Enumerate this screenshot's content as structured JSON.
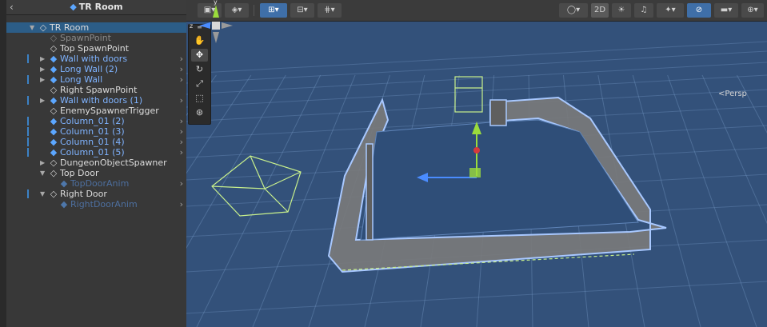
{
  "hierarchy": {
    "title": "TR Room",
    "back_icon": "chevron-left",
    "items": [
      {
        "label": "TR Room",
        "depth": 0,
        "arrow": "open",
        "icon": "cube-outline",
        "style": "white",
        "selected": true
      },
      {
        "label": "SpawnPoint",
        "depth": 1,
        "arrow": "",
        "icon": "cube-outline",
        "style": "dim"
      },
      {
        "label": "Top SpawnPoint",
        "depth": 1,
        "arrow": "",
        "icon": "cube-outline",
        "style": "white"
      },
      {
        "label": "Wall with doors",
        "depth": 1,
        "arrow": "closed",
        "icon": "prefab-cube",
        "style": "blue",
        "chevron": true,
        "bar": true
      },
      {
        "label": "Long Wall (2)",
        "depth": 1,
        "arrow": "closed",
        "icon": "prefab-cube",
        "style": "blue",
        "chevron": true
      },
      {
        "label": "Long Wall",
        "depth": 1,
        "arrow": "closed",
        "icon": "prefab-cube",
        "style": "blue",
        "chevron": true,
        "bar": true
      },
      {
        "label": "Right SpawnPoint",
        "depth": 1,
        "arrow": "",
        "icon": "cube-outline",
        "style": "white"
      },
      {
        "label": "Wall with doors (1)",
        "depth": 1,
        "arrow": "closed",
        "icon": "prefab-cube",
        "style": "blue",
        "chevron": true,
        "bar": true
      },
      {
        "label": "EnemySpawnerTrigger",
        "depth": 1,
        "arrow": "",
        "icon": "cube-outline",
        "style": "white"
      },
      {
        "label": "Column_01 (2)",
        "depth": 1,
        "arrow": "",
        "icon": "prefab-cube",
        "style": "blue",
        "chevron": true,
        "bar": true
      },
      {
        "label": "Column_01 (3)",
        "depth": 1,
        "arrow": "",
        "icon": "prefab-cube",
        "style": "blue",
        "chevron": true,
        "bar": true
      },
      {
        "label": "Column_01 (4)",
        "depth": 1,
        "arrow": "",
        "icon": "prefab-cube",
        "style": "blue",
        "chevron": true,
        "bar": true
      },
      {
        "label": "Column_01 (5)",
        "depth": 1,
        "arrow": "",
        "icon": "prefab-cube",
        "style": "blue",
        "chevron": true,
        "bar": true
      },
      {
        "label": "DungeonObjectSpawner",
        "depth": 1,
        "arrow": "closed",
        "icon": "cube-outline",
        "style": "white"
      },
      {
        "label": "Top Door",
        "depth": 1,
        "arrow": "open",
        "icon": "cube-outline",
        "style": "white"
      },
      {
        "label": "TopDoorAnim",
        "depth": 2,
        "arrow": "",
        "icon": "prefab-cube",
        "style": "bluedim",
        "chevron": true
      },
      {
        "label": "Right Door",
        "depth": 1,
        "arrow": "open",
        "icon": "cube-outline",
        "style": "white",
        "bar": true
      },
      {
        "label": "RightDoorAnim",
        "depth": 2,
        "arrow": "",
        "icon": "prefab-cube",
        "style": "bluedim",
        "chevron": true
      }
    ]
  },
  "scene": {
    "toolbar": {
      "mode_2d": "2D",
      "left_buttons": [
        "draw-mode-icon",
        "gizmo-dropdown-icon",
        "grid-snap-icon",
        "increment-snap-icon",
        "ruler-icon"
      ],
      "right_buttons": [
        "shading-mode-icon",
        "2d-toggle",
        "lighting-icon",
        "audio-icon",
        "effects-icon",
        "hidden-objects-icon",
        "camera-icon",
        "gizmos-icon"
      ]
    },
    "tools": [
      "hand-tool-icon",
      "move-tool-icon",
      "rotate-tool-icon",
      "scale-tool-icon",
      "rect-tool-icon",
      "transform-tool-icon"
    ],
    "projection_label": "Persp",
    "axes": {
      "y": "y",
      "z": "z"
    },
    "colors": {
      "background": "#33517a",
      "grid": "#7ea3cf",
      "wall": "#7a7a7a",
      "outline": "#a8c8ff",
      "selection_box": "#c8f08c"
    }
  }
}
